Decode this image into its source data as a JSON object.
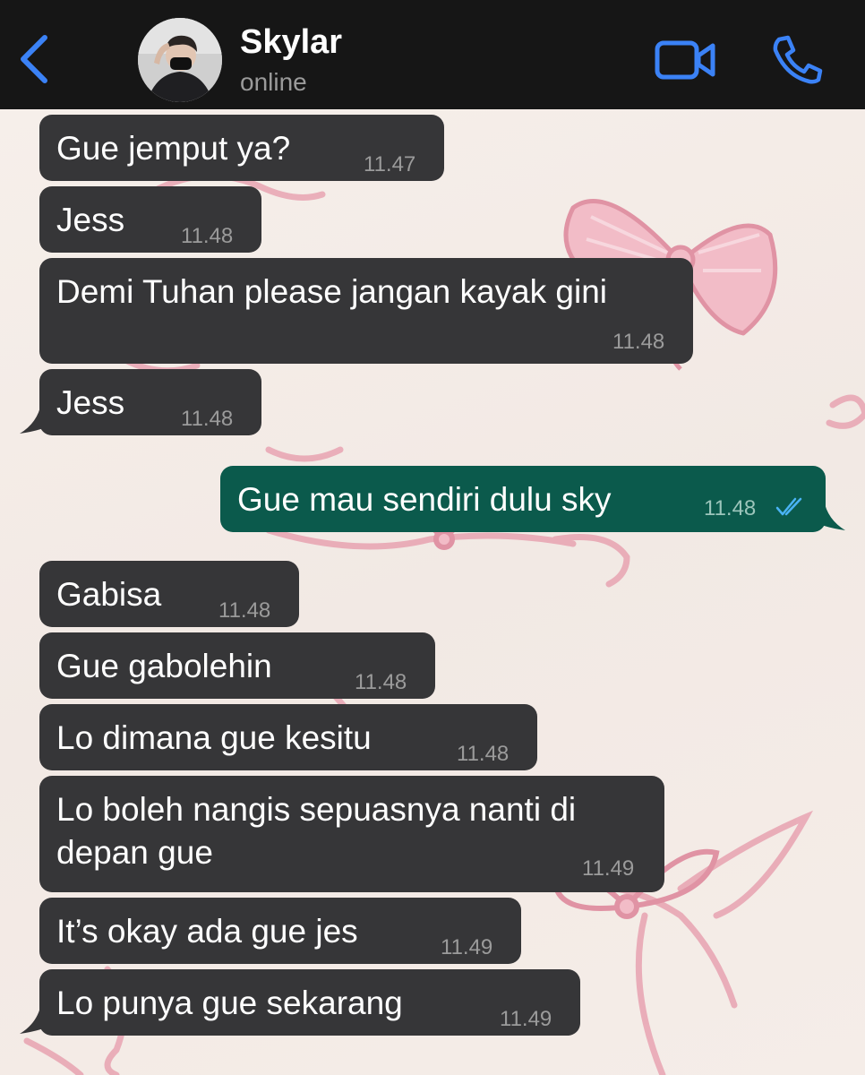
{
  "header": {
    "back_icon": "chevron-left-icon",
    "contact_name": "Skylar",
    "status": "online",
    "video_icon": "video-camera-icon",
    "call_icon": "phone-icon",
    "accent": "#3b82f6"
  },
  "colors": {
    "incoming_bubble": "#363638",
    "outgoing_bubble": "#0b5a4c",
    "header_bg": "#161616",
    "wallpaper": "#f3ebe6",
    "ribbon": "#e8a3b1"
  },
  "messages": [
    {
      "direction": "incoming",
      "text": "Gue jemput ya?",
      "time": "11.47"
    },
    {
      "direction": "incoming",
      "text": "Jess",
      "time": "11.48"
    },
    {
      "direction": "incoming",
      "text": "Demi Tuhan please jangan kayak gini",
      "time": "11.48"
    },
    {
      "direction": "incoming",
      "text": "Jess",
      "time": "11.48"
    },
    {
      "direction": "outgoing",
      "text": "Gue mau sendiri dulu sky",
      "time": "11.48",
      "status_icon": "double-check-icon"
    },
    {
      "direction": "incoming",
      "text": "Gabisa",
      "time": "11.48"
    },
    {
      "direction": "incoming",
      "text": "Gue gabolehin",
      "time": "11.48"
    },
    {
      "direction": "incoming",
      "text": "Lo dimana gue kesitu",
      "time": "11.48"
    },
    {
      "direction": "incoming",
      "text": "Lo boleh nangis sepuasnya nanti di",
      "text_line2": "depan gue",
      "time": "11.49"
    },
    {
      "direction": "incoming",
      "text": "It’s okay ada gue jes",
      "time": "11.49"
    },
    {
      "direction": "incoming",
      "text": "Lo punya gue sekarang",
      "time": "11.49"
    }
  ]
}
